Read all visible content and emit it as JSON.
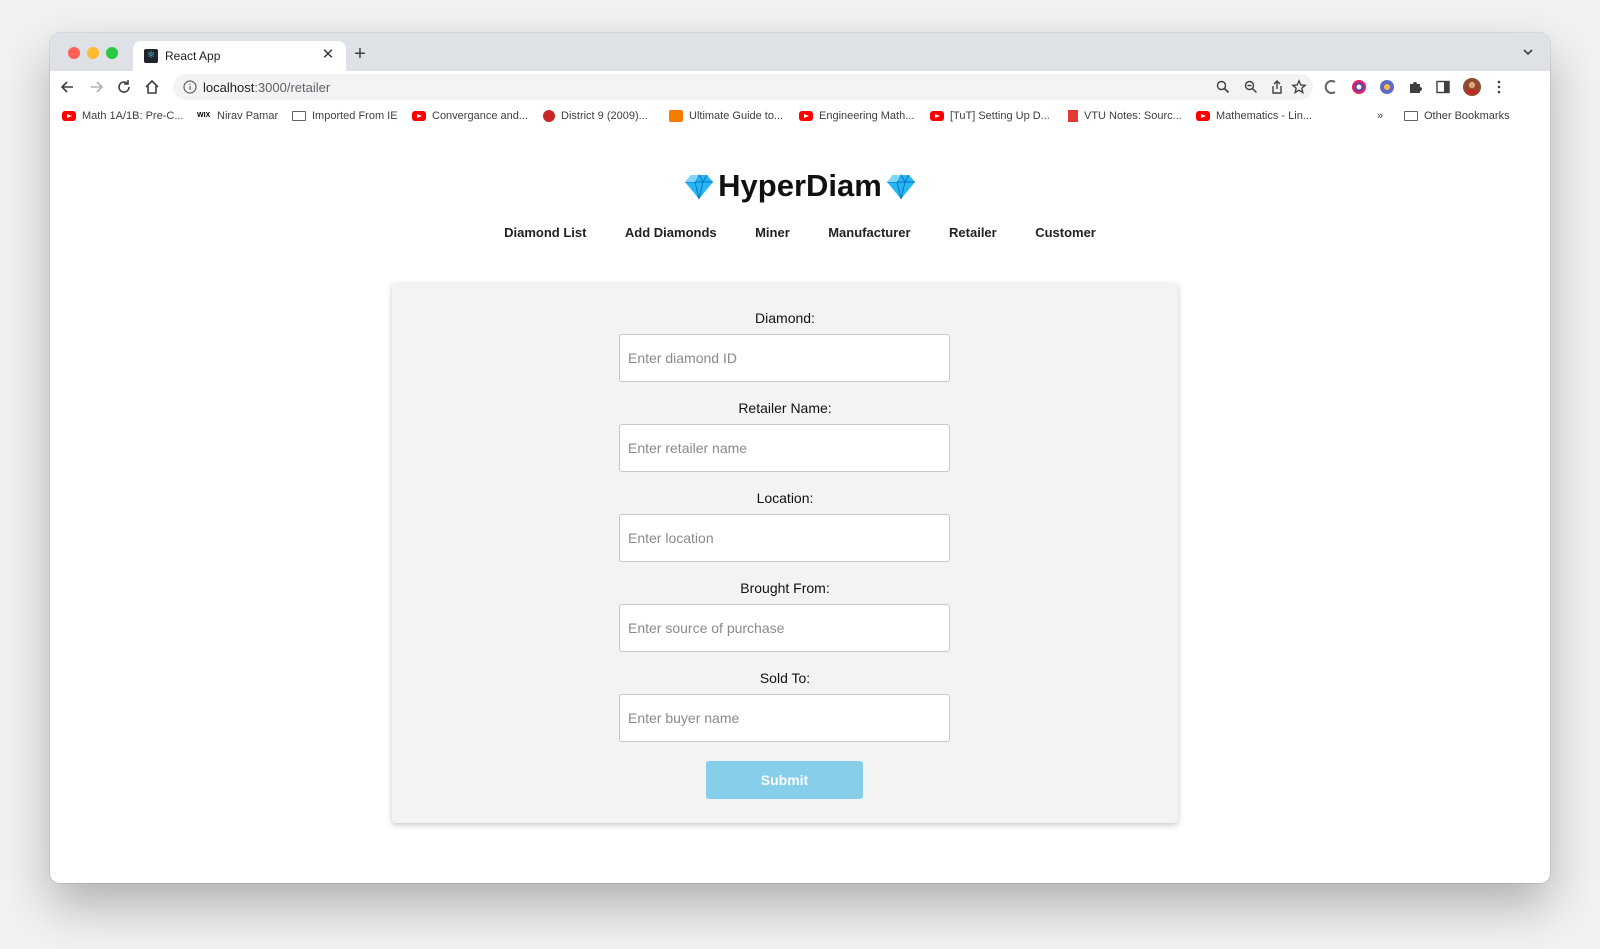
{
  "browser": {
    "tab_title": "React App",
    "url_host": "localhost",
    "url_path": ":3000/retailer",
    "bookmarks": [
      {
        "label": "Math 1A/1B: Pre-C...",
        "icon": "youtube-icon"
      },
      {
        "label": "Nirav Pamar",
        "icon": "wix-icon"
      },
      {
        "label": "Imported From IE",
        "icon": "folder-icon"
      },
      {
        "label": "Convergance and...",
        "icon": "youtube-icon"
      },
      {
        "label": "District 9 (2009)...",
        "icon": "site-icon"
      },
      {
        "label": "Ultimate Guide to...",
        "icon": "ott-icon"
      },
      {
        "label": "Engineering Math...",
        "icon": "youtube-icon"
      },
      {
        "label": "[TuT] Setting Up D...",
        "icon": "youtube-icon"
      },
      {
        "label": "VTU Notes: Sourc...",
        "icon": "vtu-icon"
      },
      {
        "label": "Mathematics - Lin...",
        "icon": "youtube-icon"
      }
    ],
    "overflow_label": "»",
    "other_bookmarks": "Other Bookmarks"
  },
  "app": {
    "brand": "HyperDiam",
    "nav": [
      "Diamond List",
      "Add Diamonds",
      "Miner",
      "Manufacturer",
      "Retailer",
      "Customer"
    ]
  },
  "form": {
    "fields": [
      {
        "label": "Diamond:",
        "placeholder": "Enter diamond ID"
      },
      {
        "label": "Retailer Name:",
        "placeholder": "Enter retailer name"
      },
      {
        "label": "Location:",
        "placeholder": "Enter location"
      },
      {
        "label": "Brought From:",
        "placeholder": "Enter source of purchase"
      },
      {
        "label": "Sold To:",
        "placeholder": "Enter buyer name"
      }
    ],
    "submit_label": "Submit"
  },
  "colors": {
    "submit_button": "#87ceeb",
    "card_background": "#f3f3f3",
    "gem": "#29b6f6"
  }
}
